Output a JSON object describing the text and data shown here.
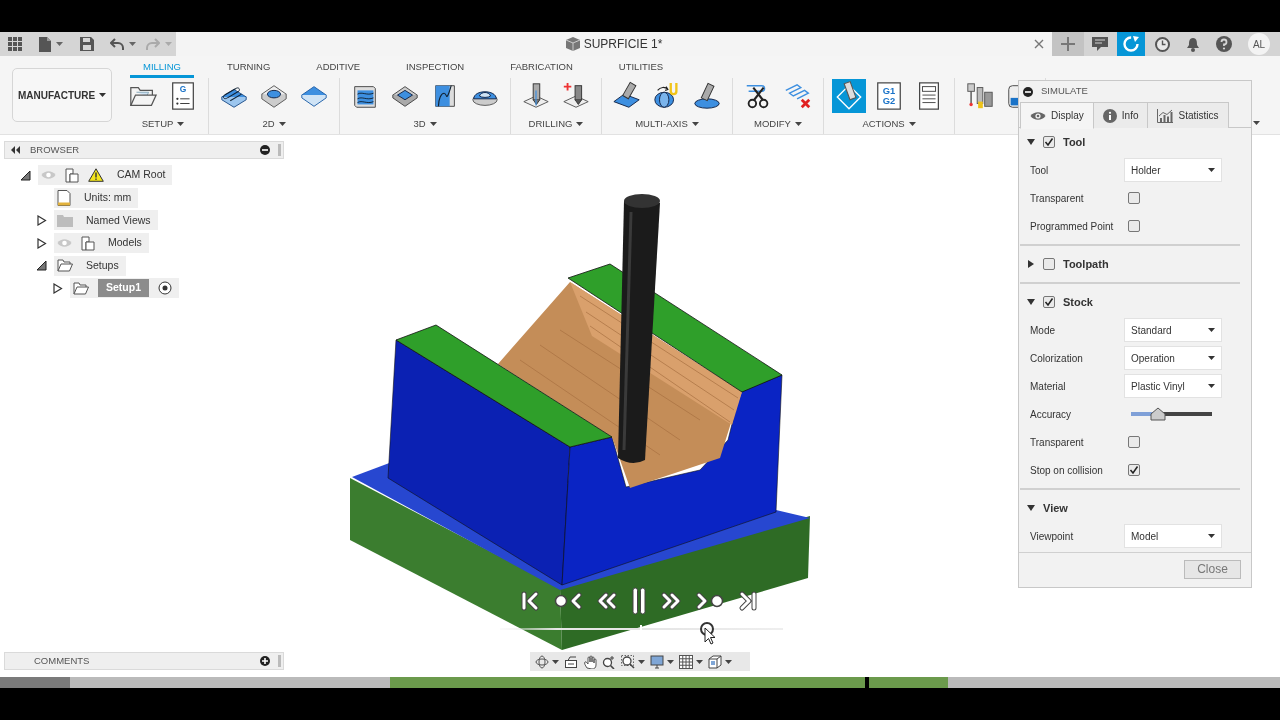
{
  "app_bar": {
    "document_title": "SUPRFICIE 1*",
    "avatar_initials": "AL"
  },
  "toolbar": {
    "workspace": "MANUFACTURE",
    "tabs": [
      {
        "label": "MILLING",
        "selected": true
      },
      {
        "label": "TURNING",
        "selected": false
      },
      {
        "label": "ADDITIVE",
        "selected": false
      },
      {
        "label": "INSPECTION",
        "selected": false
      },
      {
        "label": "FABRICATION",
        "selected": false
      },
      {
        "label": "UTILITIES",
        "selected": false
      }
    ],
    "groups": [
      {
        "label": "SETUP",
        "tools": [
          {
            "kind": "folder-open",
            "active": false
          },
          {
            "kind": "nc-program",
            "lines": [
              "G"
            ],
            "active": false
          }
        ]
      },
      {
        "label": "2D",
        "tools": [
          {
            "kind": "adaptive-2d",
            "active": false
          },
          {
            "kind": "pocket-2d",
            "active": false
          },
          {
            "kind": "face",
            "active": false
          }
        ]
      },
      {
        "label": "3D",
        "tools": [
          {
            "kind": "adaptive-3d",
            "active": false
          },
          {
            "kind": "pocket-3d",
            "active": false
          },
          {
            "kind": "parallel",
            "active": false
          },
          {
            "kind": "scallop",
            "active": false
          }
        ]
      },
      {
        "label": "DRILLING",
        "tools": [
          {
            "kind": "drill",
            "active": false
          },
          {
            "kind": "drill-plus",
            "active": false
          }
        ]
      },
      {
        "label": "MULTI-AXIS",
        "tools": [
          {
            "kind": "swarf",
            "active": false
          },
          {
            "kind": "rotary",
            "active": false
          },
          {
            "kind": "tilt",
            "active": false
          }
        ]
      },
      {
        "label": "MODIFY",
        "tools": [
          {
            "kind": "scissors",
            "active": false
          },
          {
            "kind": "delete-path",
            "active": false
          }
        ]
      },
      {
        "label": "ACTIONS",
        "tools": [
          {
            "kind": "simulate",
            "active": true
          },
          {
            "kind": "gcode",
            "lines": [
              "G1",
              "G2"
            ],
            "active": false
          },
          {
            "kind": "setup-sheet",
            "active": false
          }
        ]
      },
      {
        "tools": [
          {
            "kind": "tool-library",
            "active": false
          },
          {
            "kind": "machine",
            "active": false
          }
        ]
      }
    ]
  },
  "simulate": {
    "title": "SIMULATE",
    "tabs": [
      {
        "label": "Display",
        "kind": "display",
        "selected": true
      },
      {
        "label": "Info",
        "kind": "info",
        "selected": false
      },
      {
        "label": "Statistics",
        "kind": "statistics",
        "selected": false
      }
    ],
    "sections": [
      {
        "title": "Tool",
        "checked": true,
        "expanded": true,
        "rows": [
          {
            "kind": "select",
            "label": "Tool",
            "value": "Holder"
          },
          {
            "kind": "checkbox",
            "label": "Transparent",
            "checked": false
          },
          {
            "kind": "checkbox",
            "label": "Programmed Point",
            "checked": false
          }
        ]
      },
      {
        "title": "Toolpath",
        "checked": false,
        "expanded": false
      },
      {
        "title": "Stock",
        "checked": true,
        "expanded": true,
        "rows": [
          {
            "kind": "select",
            "label": "Mode",
            "value": "Standard"
          },
          {
            "kind": "select",
            "label": "Colorization",
            "value": "Operation"
          },
          {
            "kind": "select",
            "label": "Material",
            "value": "Plastic Vinyl"
          },
          {
            "kind": "slider",
            "label": "Accuracy",
            "level": 0.33
          },
          {
            "kind": "checkbox",
            "label": "Transparent",
            "checked": false
          },
          {
            "kind": "checkbox",
            "label": "Stop on collision",
            "checked": true
          }
        ]
      },
      {
        "title": "View",
        "expanded": true,
        "rows": [
          {
            "kind": "select",
            "label": "Viewpoint",
            "value": "Model"
          }
        ]
      }
    ],
    "close_button": "Close"
  },
  "browser": {
    "title": "BROWSER",
    "tree": [
      {
        "label": "CAM Root",
        "kind": "root",
        "expanded": true,
        "selected": false,
        "children": [
          {
            "label": "Units: mm",
            "kind": "units",
            "selected": false
          },
          {
            "label": "Named Views",
            "kind": "folder",
            "expanded": false,
            "selected": false
          },
          {
            "label": "Models",
            "kind": "models",
            "expanded": false,
            "selected": false
          },
          {
            "label": "Setups",
            "kind": "setups",
            "expanded": true,
            "selected": false,
            "children": [
              {
                "label": "Setup1",
                "kind": "setup",
                "expanded": false,
                "selected": true
              }
            ]
          }
        ]
      }
    ]
  },
  "viewport": {
    "playback": {
      "level": 0.73
    }
  },
  "comments": {
    "title": "COMMENTS"
  }
}
